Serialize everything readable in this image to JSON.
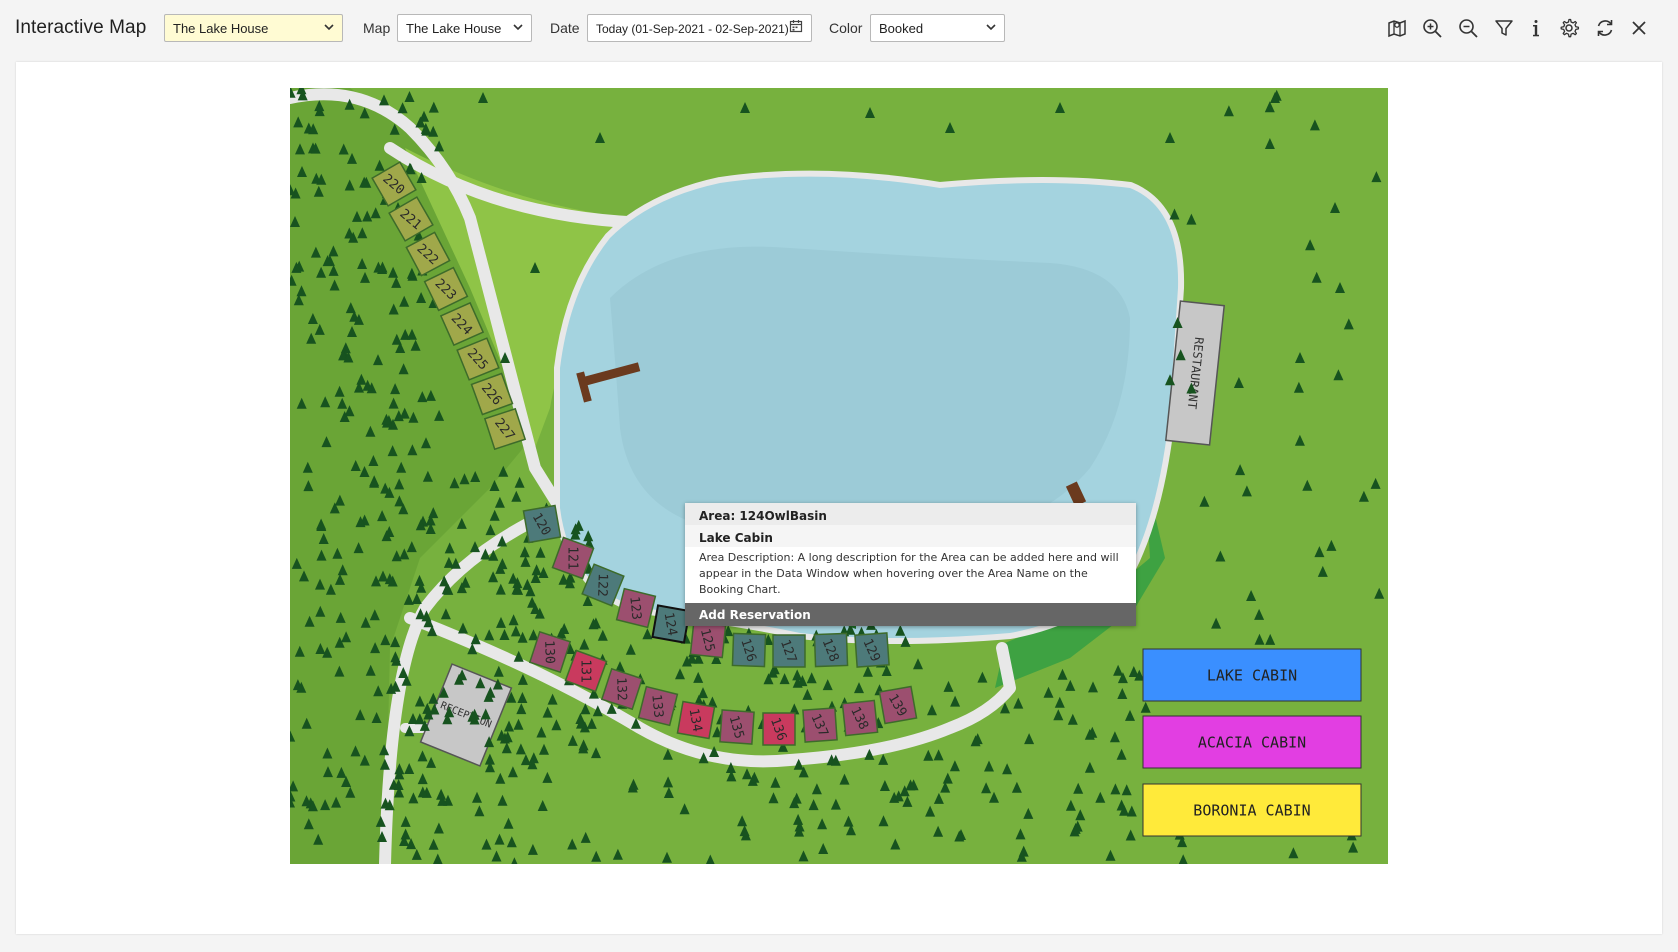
{
  "header": {
    "title": "Interactive Map",
    "property_select": "The Lake House",
    "map_label": "Map",
    "map_select": "The Lake House",
    "date_label": "Date",
    "date_value": "Today (01-Sep-2021 - 02-Sep-2021)",
    "color_label": "Color",
    "color_select": "Booked"
  },
  "icons": [
    "map-icon",
    "zoom-in-icon",
    "zoom-out-icon",
    "filter-icon",
    "info-icon",
    "gear-icon",
    "refresh-icon",
    "close-icon"
  ],
  "map": {
    "buildings": {
      "restaurant": "RESTAURANT",
      "reception": "RECEPTION"
    },
    "cabins_upper": [
      "220",
      "221",
      "222",
      "223",
      "224",
      "225",
      "226",
      "227"
    ],
    "cabins_middle": [
      "120",
      "121",
      "122",
      "123",
      "124",
      "125",
      "126",
      "127",
      "128",
      "129"
    ],
    "cabins_lower": [
      "130",
      "131",
      "132",
      "133",
      "134",
      "135",
      "136",
      "137",
      "138",
      "139"
    ],
    "legend": [
      {
        "label": "LAKE CABIN",
        "color": "#3a8fff"
      },
      {
        "label": "ACACIA CABIN",
        "color": "#e23ee2"
      },
      {
        "label": "BORONIA CABIN",
        "color": "#ffea3a"
      }
    ]
  },
  "tooltip": {
    "area": "Area: 124OwlBasin",
    "category": "Lake Cabin",
    "description": "Area Description: A long description for the Area can be added here and will appear in the Data Window when hovering over the Area Name on the Booking Chart.",
    "action": "Add Reservation"
  },
  "colors": {
    "grass": "#77b13e",
    "dark_grass": "#5f9a31",
    "light_grass": "#8fc447",
    "lake": "#a4d3df",
    "path": "#e8e8e8",
    "cabin_lake": "#4d7a7a",
    "cabin_acacia": "#9c4f6f",
    "cabin_red": "#c93a5e",
    "cabin_boronia": "#a0a84a"
  }
}
